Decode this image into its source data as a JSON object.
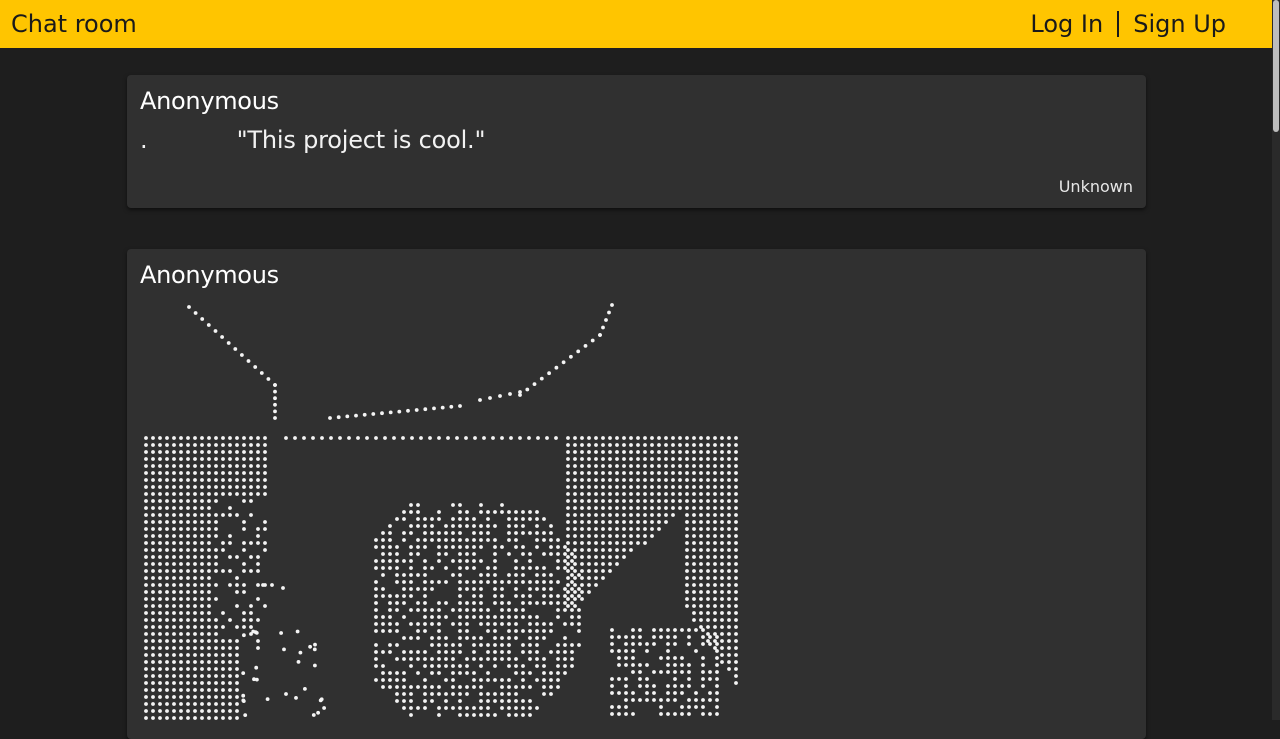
{
  "header": {
    "title": "Chat room",
    "login_label": "Log In",
    "signup_label": "Sign Up"
  },
  "messages": [
    {
      "author": "Anonymous",
      "text": ".            \"This project is cool.\"",
      "meta": "Unknown"
    },
    {
      "author": "Anonymous",
      "content_type": "braille-ascii-art"
    }
  ],
  "colors": {
    "header_bg": "#ffc500",
    "page_bg": "#1e1e1e",
    "card_bg": "#303030",
    "text": "#f2f2f2"
  }
}
